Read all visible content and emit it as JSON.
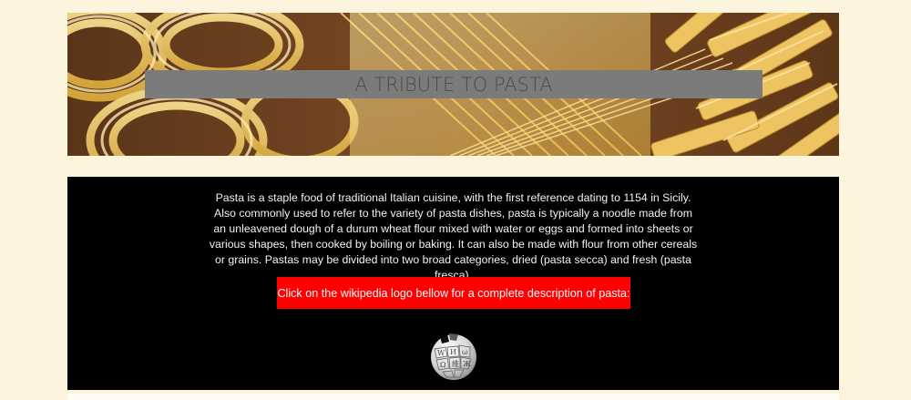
{
  "header": {
    "title": "A TRIBUTE TO PASTA"
  },
  "main": {
    "lines": [
      "Pasta is a staple food of traditional Italian cuisine, with the first reference dating to 1154 in Sicily.",
      "Also commonly used to refer to the variety of pasta dishes, pasta is typically a noodle made from",
      "an unleavened dough of a durum wheat flour mixed with water or eggs and formed into sheets or",
      "various shapes, then cooked by boiling or baking. It can also be made with flour from other cereals",
      "or grains. Pastas may be divided into two broad categories, dried (pasta secca) and fresh (pasta fresca)."
    ],
    "link_prompt": "Click on the wikipedia logo bellow for a complete description of pasta:",
    "logo_icon": "wikipedia-globe-icon"
  },
  "colors": {
    "page_background": "#fdf4dd",
    "title_bar": "#7b7b7b",
    "title_text": "#4a4a4a",
    "content_background": "#000000",
    "link_box": "#ff0000"
  }
}
